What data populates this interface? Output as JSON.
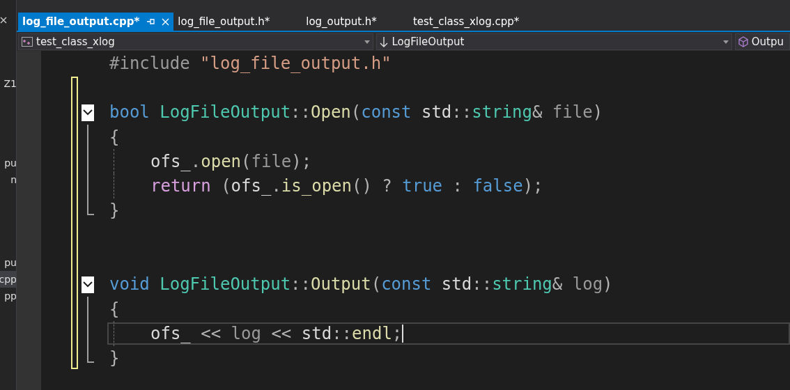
{
  "side_panel": {
    "items": [
      {
        "text": "Z1",
        "selected": false
      },
      {
        "text": "pu",
        "selected": false
      },
      {
        "text": "n",
        "selected": false
      },
      {
        "text": "pu",
        "selected": false
      },
      {
        "text": "cpp",
        "selected": true
      },
      {
        "text": "pp",
        "selected": false
      }
    ]
  },
  "tabs": [
    {
      "label": "log_file_output.cpp*",
      "selected": true
    },
    {
      "label": "log_file_output.h*",
      "selected": false
    },
    {
      "label": "log_output.h*",
      "selected": false
    },
    {
      "label": "test_class_xlog.cpp*",
      "selected": false
    }
  ],
  "nav_bar": {
    "project": "test_class_xlog",
    "scope": "LogFileOutput",
    "member": "Outpu"
  },
  "code_lines": [
    {
      "changed": false,
      "indented": false,
      "current": false,
      "tokens": [
        {
          "kind": "pre",
          "text": "#include "
        },
        {
          "kind": "str",
          "text": "\"log_file_output.h\""
        }
      ]
    },
    {
      "changed": true,
      "indented": false,
      "current": false
    },
    {
      "changed": true,
      "indented": false,
      "current": false,
      "expanded": true,
      "tokens": [
        {
          "kind": "kw",
          "text": "bool "
        },
        {
          "kind": "type",
          "text": "LogFileOutput"
        },
        {
          "kind": "punct",
          "text": "::"
        },
        {
          "kind": "fn",
          "text": "Open"
        },
        {
          "kind": "punct",
          "text": "("
        },
        {
          "kind": "kw",
          "text": "const "
        },
        {
          "kind": "plain",
          "text": "std"
        },
        {
          "kind": "punct",
          "text": "::"
        },
        {
          "kind": "type",
          "text": "string"
        },
        {
          "kind": "punct",
          "text": "& "
        },
        {
          "kind": "param",
          "text": "file"
        },
        {
          "kind": "punct",
          "text": ")"
        }
      ],
      "children": [
        {
          "changed": true,
          "indented": false,
          "current": false,
          "tokens": [
            {
              "kind": "punct",
              "text": "{"
            }
          ]
        },
        {
          "changed": true,
          "indented": true,
          "current": false,
          "tokens": [
            {
              "kind": "plain",
              "text": "ofs_"
            },
            {
              "kind": "punct",
              "text": "."
            },
            {
              "kind": "fn",
              "text": "open"
            },
            {
              "kind": "punct",
              "text": "("
            },
            {
              "kind": "param",
              "text": "file"
            },
            {
              "kind": "punct",
              "text": ");"
            }
          ]
        },
        {
          "changed": true,
          "indented": true,
          "current": false,
          "tokens": [
            {
              "kind": "ctrl",
              "text": "return "
            },
            {
              "kind": "punct",
              "text": "("
            },
            {
              "kind": "plain",
              "text": "ofs_"
            },
            {
              "kind": "punct",
              "text": "."
            },
            {
              "kind": "fn",
              "text": "is_open"
            },
            {
              "kind": "punct",
              "text": "() ? "
            },
            {
              "kind": "kw",
              "text": "true"
            },
            {
              "kind": "punct",
              "text": " : "
            },
            {
              "kind": "kw",
              "text": "false"
            },
            {
              "kind": "punct",
              "text": ");"
            }
          ]
        },
        {
          "changed": true,
          "indented": false,
          "current": false,
          "tokens": [
            {
              "kind": "punct",
              "text": "}"
            }
          ]
        }
      ]
    },
    {
      "changed": true,
      "indented": false,
      "current": false
    },
    {
      "changed": true,
      "indented": false,
      "current": false
    },
    {
      "changed": true,
      "indented": false,
      "current": false,
      "expanded": true,
      "tokens": [
        {
          "kind": "kw",
          "text": "void "
        },
        {
          "kind": "type",
          "text": "LogFileOutput"
        },
        {
          "kind": "punct",
          "text": "::"
        },
        {
          "kind": "fn",
          "text": "Output"
        },
        {
          "kind": "punct",
          "text": "("
        },
        {
          "kind": "kw",
          "text": "const "
        },
        {
          "kind": "plain",
          "text": "std"
        },
        {
          "kind": "punct",
          "text": "::"
        },
        {
          "kind": "type",
          "text": "string"
        },
        {
          "kind": "punct",
          "text": "& "
        },
        {
          "kind": "param",
          "text": "log"
        },
        {
          "kind": "punct",
          "text": ")"
        }
      ],
      "children": [
        {
          "changed": true,
          "indented": false,
          "current": false,
          "tokens": [
            {
              "kind": "punct",
              "text": "{"
            }
          ]
        },
        {
          "changed": true,
          "indented": true,
          "current": true,
          "tokens": [
            {
              "kind": "plain",
              "text": "ofs_ "
            },
            {
              "kind": "punct",
              "text": "<< "
            },
            {
              "kind": "param",
              "text": "log "
            },
            {
              "kind": "punct",
              "text": "<< "
            },
            {
              "kind": "plain",
              "text": "std"
            },
            {
              "kind": "punct",
              "text": "::"
            },
            {
              "kind": "fn",
              "text": "endl"
            },
            {
              "kind": "punct",
              "text": ";"
            }
          ]
        },
        {
          "changed": true,
          "indented": false,
          "current": false,
          "tokens": [
            {
              "kind": "punct",
              "text": "}"
            }
          ]
        }
      ]
    }
  ]
}
